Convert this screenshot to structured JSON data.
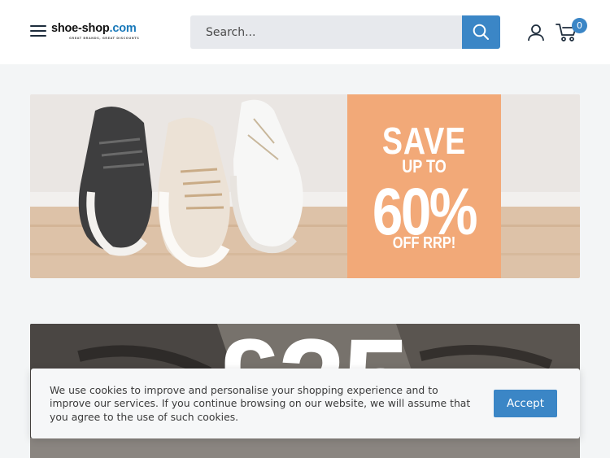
{
  "header": {
    "logo": {
      "main": "shoe-shop",
      "tld": ".com",
      "tagline": "GREAT BRANDS, GREAT DISCOUNTS"
    },
    "search": {
      "placeholder": "Search..."
    },
    "cart": {
      "count": "0"
    }
  },
  "promo_banner_1": {
    "line1": "SAVE",
    "line2": "UP TO",
    "line3": "60%",
    "line4": "OFF RRP!"
  },
  "promo_banner_2": {
    "price": "£25"
  },
  "cookie_notice": {
    "text": "We use cookies to improve and personalise your shopping experience and to improve our services. If you continue browsing on our website, we will assume that you agree to the use of such cookies.",
    "accept_label": "Accept"
  },
  "colors": {
    "accent": "#3b86c6",
    "promo_orange": "#f2a978",
    "page_background": "#f3f5f6",
    "header_background": "#ffffff"
  },
  "icons": {
    "menu": "hamburger-menu-icon",
    "search": "search-icon",
    "account": "user-account-icon",
    "cart": "shopping-cart-icon"
  }
}
